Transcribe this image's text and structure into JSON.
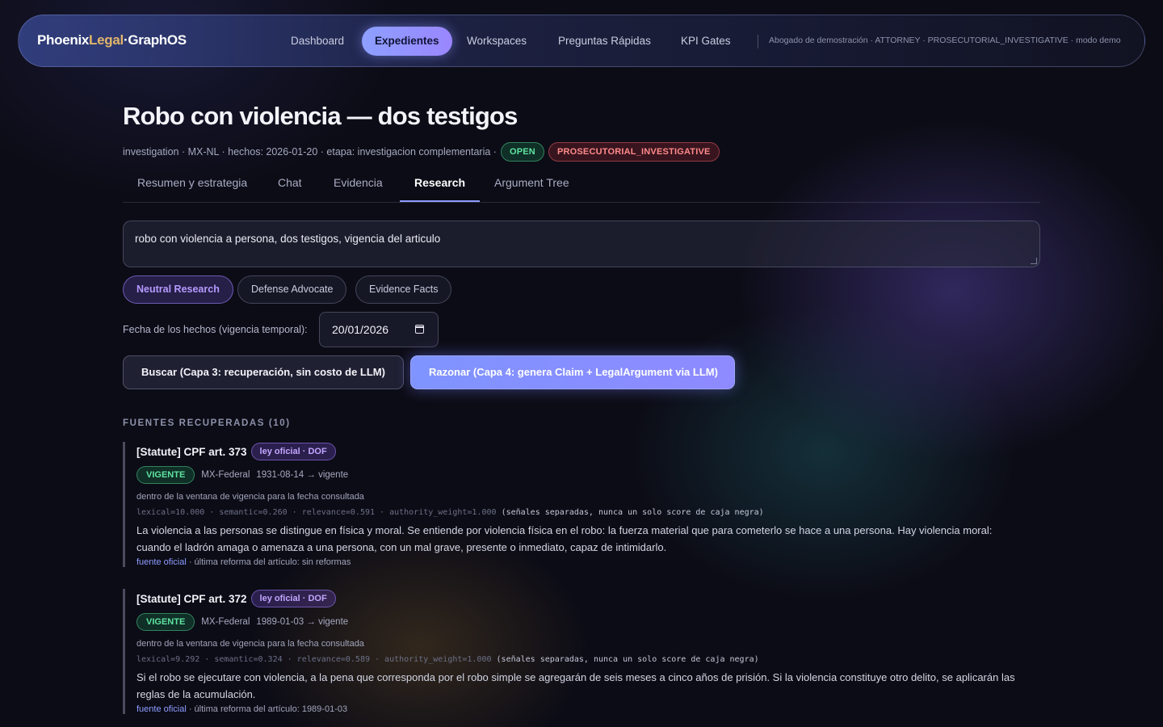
{
  "nav": {
    "brand": {
      "part1": "Phoenix",
      "part2": "Legal",
      "sep": "·",
      "part3": "GraphOS"
    },
    "items": [
      {
        "label": "Dashboard",
        "active": false
      },
      {
        "label": "Expedientes",
        "active": true
      },
      {
        "label": "Workspaces",
        "active": false
      },
      {
        "label": "Preguntas Rápidas",
        "active": false
      },
      {
        "label": "KPI Gates",
        "active": false
      }
    ],
    "user": "Abogado de demostración · ATTORNEY · PROSECUTORIAL_INVESTIGATIVE · modo demo"
  },
  "case": {
    "title": "Robo con violencia — dos testigos",
    "meta": "investigation · MX-NL · hechos: 2026-01-20 · etapa: investigacion complementaria ·",
    "status_badge": "OPEN",
    "role_badge": "PROSECUTORIAL_INVESTIGATIVE"
  },
  "tabs": [
    {
      "label": "Resumen y estrategia",
      "active": false
    },
    {
      "label": "Chat",
      "active": false
    },
    {
      "label": "Evidencia",
      "active": false
    },
    {
      "label": "Research",
      "active": true
    },
    {
      "label": "Argument Tree",
      "active": false
    }
  ],
  "research": {
    "query": "robo con violencia a persona, dos testigos, vigencia del articulo",
    "modes": [
      {
        "label": "Neutral Research",
        "active": true
      },
      {
        "label": "Defense Advocate",
        "active": false
      },
      {
        "label": "Evidence Facts",
        "active": false
      }
    ],
    "date_label": "Fecha de los hechos (vigencia temporal):",
    "date_value": "20/01/2026",
    "search_button": "Buscar (Capa 3: recuperación, sin costo de LLM)",
    "reason_button": "Razonar (Capa 4: genera Claim + LegalArgument via LLM)",
    "sources_title": "FUENTES RECUPERADAS (10)",
    "sources": [
      {
        "title": "[Statute] CPF art. 373",
        "law_badge": "ley oficial · DOF",
        "status": "VIGENTE",
        "jurisdiction": "MX-Federal",
        "period": "1931-08-14 → vigente",
        "window": "dentro de la ventana de vigencia para la fecha consultada",
        "scores": "lexical=10.000 · semantic=0.260 · relevance=0.591 · authority_weight=1.000",
        "scores_note": "(señales separadas, nunca un solo score de caja negra)",
        "text": "La violencia a las personas se distingue en física y moral. Se entiende por violencia física en el robo: la fuerza material que para cometerlo se hace a una persona. Hay violencia moral: cuando el ladrón amaga o amenaza a una persona, con un mal grave, presente o inmediato, capaz de intimidarlo.",
        "link": "fuente oficial",
        "reform": "· última reforma del artículo: sin reformas"
      },
      {
        "title": "[Statute] CPF art. 372",
        "law_badge": "ley oficial · DOF",
        "status": "VIGENTE",
        "jurisdiction": "MX-Federal",
        "period": "1989-01-03 → vigente",
        "window": "dentro de la ventana de vigencia para la fecha consultada",
        "scores": "lexical=9.292 · semantic=0.324 · relevance=0.589 · authority_weight=1.000",
        "scores_note": "(señales separadas, nunca un solo score de caja negra)",
        "text": "Si el robo se ejecutare con violencia, a la pena que corresponda por el robo simple se agregarán de seis meses a cinco años de prisión. Si la violencia constituye otro delito, se aplicarán las reglas de la acumulación.",
        "link": "fuente oficial",
        "reform": "· última reforma del artículo: 1989-01-03"
      }
    ]
  }
}
